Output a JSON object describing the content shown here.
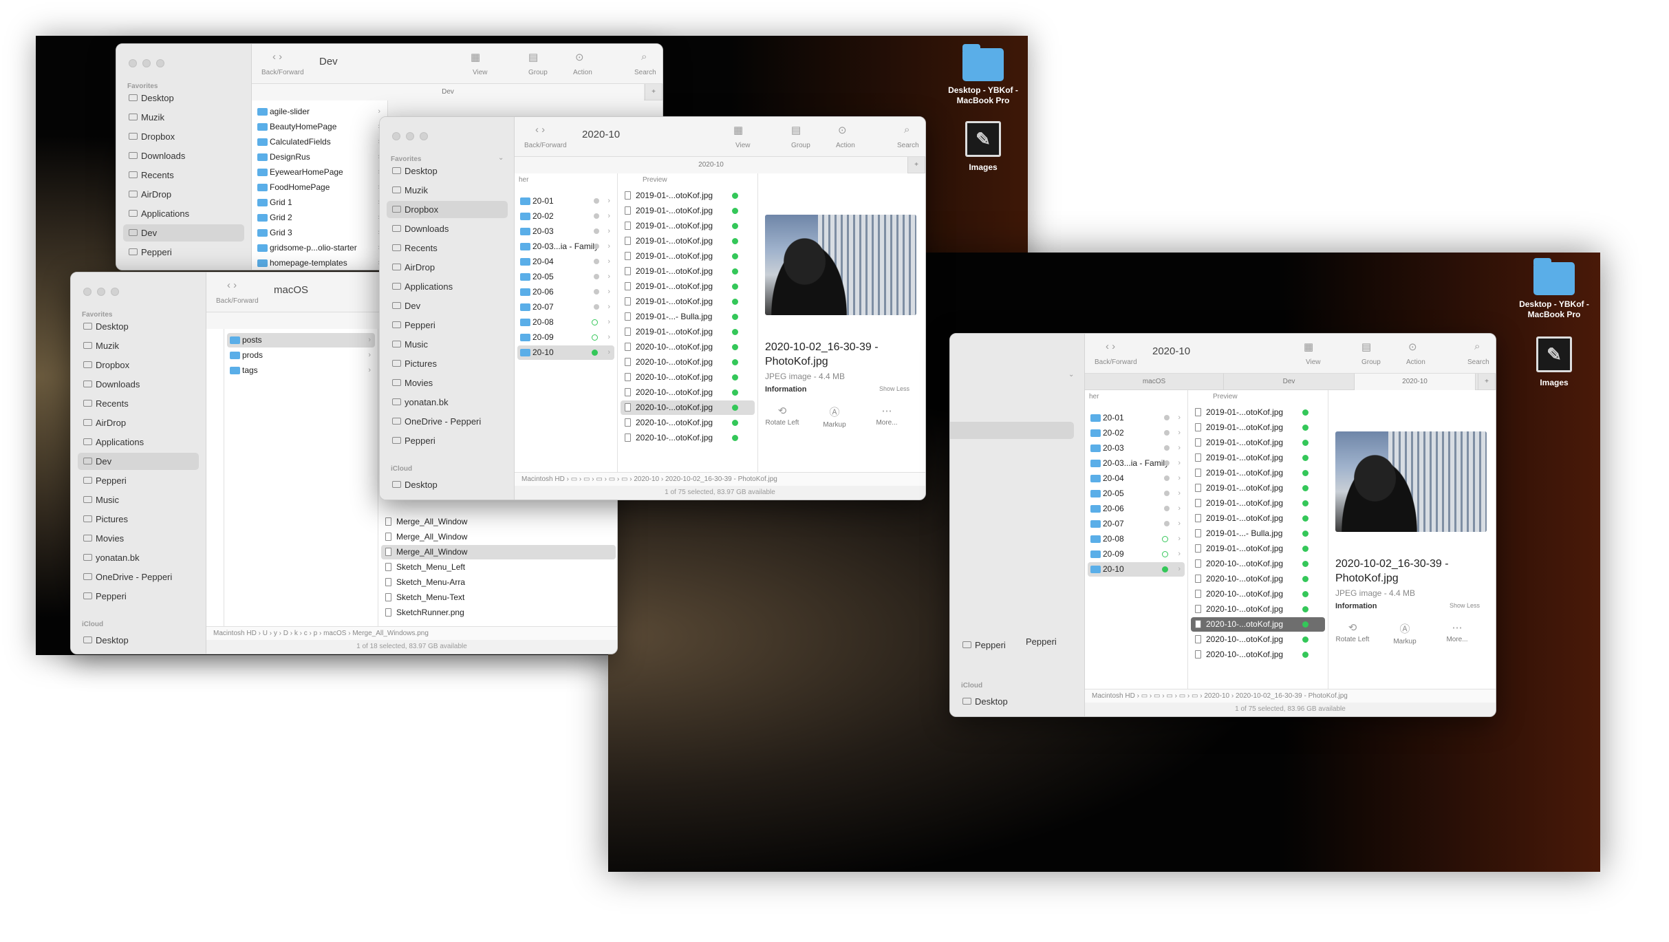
{
  "desktop_icons": {
    "folder_label": "Desktop - YBKof - MacBook Pro",
    "images_label": "Images"
  },
  "toolbar_labels": {
    "back_forward": "Back/Forward",
    "view": "View",
    "group": "Group",
    "action": "Action",
    "search": "Search"
  },
  "sidebar_heads": {
    "favorites": "Favorites",
    "icloud": "iCloud"
  },
  "win_dev": {
    "title": "Dev",
    "tab": "Dev",
    "sidebar": [
      "Desktop",
      "Muzik",
      "Dropbox",
      "Downloads",
      "Recents",
      "AirDrop",
      "Applications",
      "Dev",
      "Pepperi"
    ],
    "files": [
      "agile-slider",
      "BeautyHomePage",
      "CalculatedFields",
      "DesignRus",
      "EyewearHomePage",
      "FoodHomePage",
      "Grid 1",
      "Grid 2",
      "Grid 3",
      "gridsome-p...olio-starter",
      "homepage-templates"
    ]
  },
  "win_macos": {
    "title": "macOS",
    "sidebar": [
      "Desktop",
      "Muzik",
      "Dropbox",
      "Downloads",
      "Recents",
      "AirDrop",
      "Applications",
      "Dev",
      "Pepperi",
      "Music",
      "Pictures",
      "Movies",
      "yonatan.bk",
      "OneDrive - Pepperi",
      "Pepperi"
    ],
    "icloud_desktop": "Desktop",
    "folders": [
      "posts",
      "prods",
      "tags"
    ],
    "pngs": [
      "Merge_All_Window",
      "Merge_All_Window",
      "Merge_All_Window",
      "Sketch_Menu_Left",
      "Sketch_Menu-Arra",
      "Sketch_Menu-Text",
      "SketchRunner.png"
    ],
    "path": [
      "Macintosh HD",
      "U",
      "y",
      "D",
      "k",
      "c",
      "p",
      "macOS",
      "Merge_All_Windows.png"
    ],
    "status": "1 of 18 selected, 83.97 GB available"
  },
  "win_2020": {
    "title": "2020-10",
    "tab": "2020-10",
    "sidebar": [
      "Desktop",
      "Muzik",
      "Dropbox",
      "Downloads",
      "Recents",
      "AirDrop",
      "Applications",
      "Dev",
      "Pepperi",
      "Music",
      "Pictures",
      "Movies",
      "yonatan.bk",
      "OneDrive - Pepperi",
      "Pepperi"
    ],
    "icloud_desktop": "Desktop",
    "col1_header": "her",
    "col1": [
      "20-01",
      "20-02",
      "20-03",
      "20-03...ia - Family",
      "20-04",
      "20-05",
      "20-06",
      "20-07",
      "20-08",
      "20-09",
      "20-10"
    ],
    "col2_header": "Preview",
    "col2": [
      "2019-01-...otoKof.jpg",
      "2019-01-...otoKof.jpg",
      "2019-01-...otoKof.jpg",
      "2019-01-...otoKof.jpg",
      "2019-01-...otoKof.jpg",
      "2019-01-...otoKof.jpg",
      "2019-01-...otoKof.jpg",
      "2019-01-...otoKof.jpg",
      "2019-01-...- Bulla.jpg",
      "2019-01-...otoKof.jpg",
      "2020-10-...otoKof.jpg",
      "2020-10-...otoKof.jpg",
      "2020-10-...otoKof.jpg",
      "2020-10-...otoKof.jpg",
      "2020-10-...otoKof.jpg",
      "2020-10-...otoKof.jpg",
      "2020-10-...otoKof.jpg"
    ],
    "preview_title": "2020-10-02_16-30-39 - PhotoKof.jpg",
    "preview_sub": "JPEG image - 4.4 MB",
    "information": "Information",
    "show_less": "Show Less",
    "actions": [
      "Rotate Left",
      "Markup",
      "More..."
    ],
    "path": [
      "Macintosh HD",
      "2020-10",
      "2020-10-02_16-30-39 - PhotoKof.jpg"
    ],
    "status": "1 of 75 selected, 83.97 GB available"
  },
  "win_right": {
    "title": "2020-10",
    "tabs": [
      "macOS",
      "Dev",
      "2020-10"
    ],
    "sidebar_visible": [
      "Pepperi",
      "Pepperi"
    ],
    "icloud_desktop": "Desktop",
    "status": "1 of 75 selected, 83.96 GB available"
  }
}
